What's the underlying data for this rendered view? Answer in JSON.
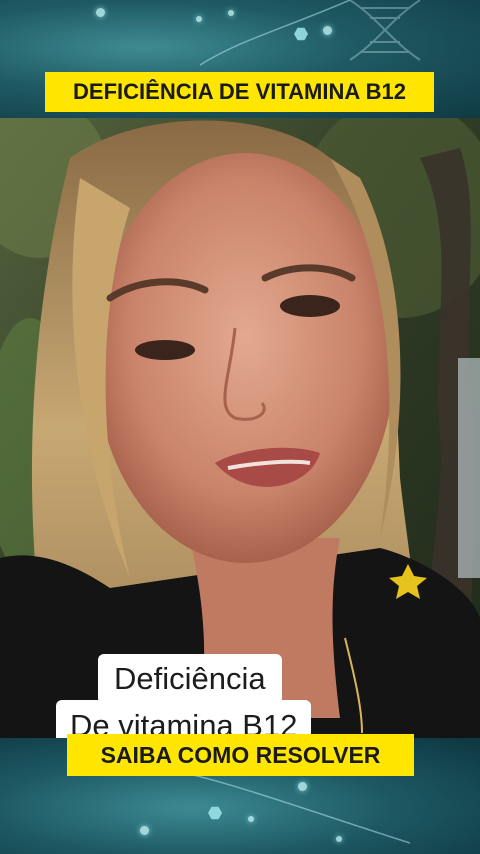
{
  "header": {
    "banner_text": "DEFICIÊNCIA DE VITAMINA B12"
  },
  "photo": {
    "caption_line_1": "Deficiência",
    "caption_line_2": "De vitamina B12"
  },
  "footer": {
    "banner_text": "SAIBA COMO RESOLVER"
  },
  "colors": {
    "banner_yellow": "#ffe600",
    "band_teal": "#1f5a63",
    "caption_white": "#ffffff"
  }
}
